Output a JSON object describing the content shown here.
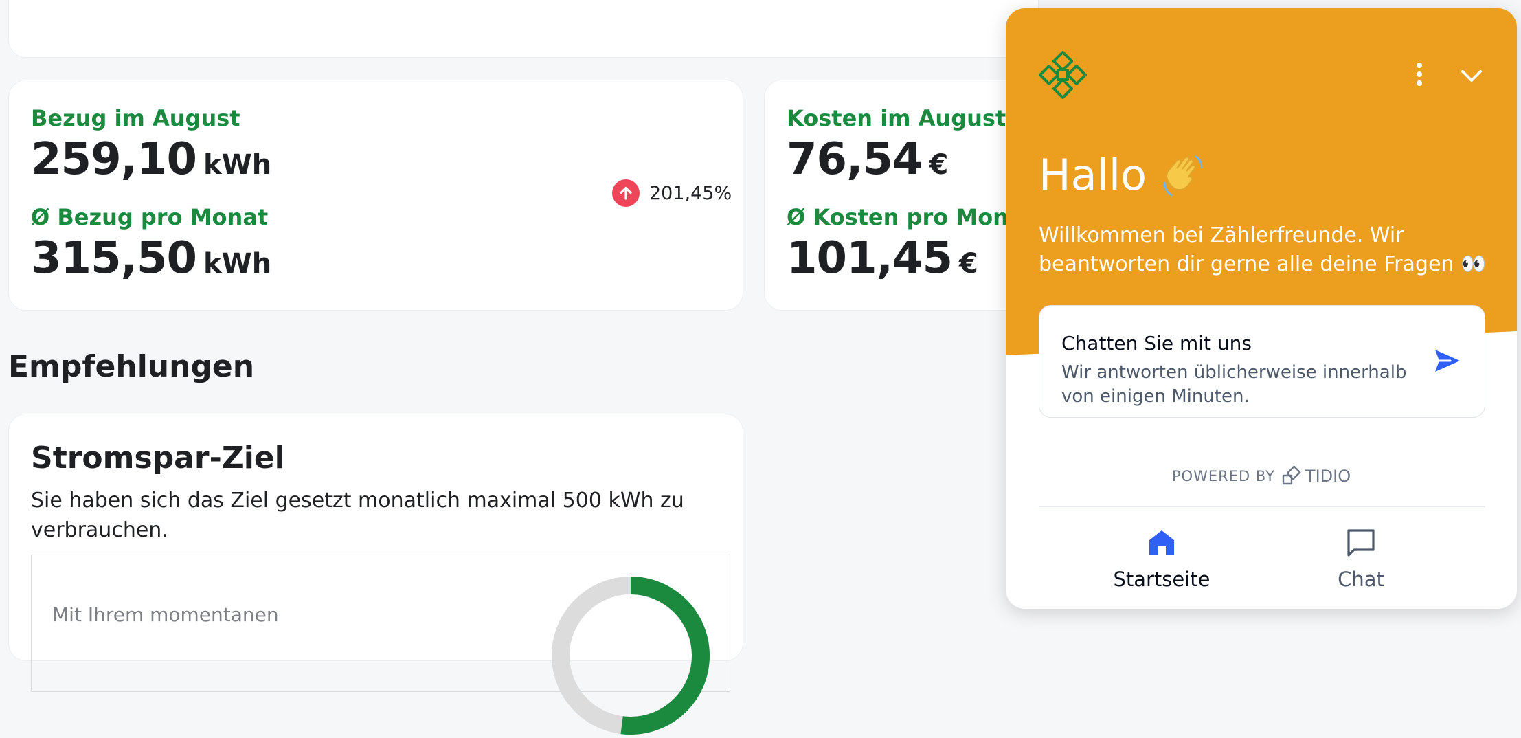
{
  "stats": {
    "bezug": {
      "label": "Bezug im August",
      "value": "259,10",
      "unit": "kWh",
      "avg_label": "Ø Bezug pro Monat",
      "avg_value": "315,50",
      "avg_unit": "kWh",
      "trend_value": "201,45%"
    },
    "kosten": {
      "label": "Kosten im August",
      "value": "76,54",
      "unit": "€",
      "avg_label": "Ø Kosten pro Monat",
      "avg_value": "101,45",
      "avg_unit": "€"
    }
  },
  "recommendations": {
    "section_title": "Empfehlungen",
    "goal": {
      "title": "Stromspar-Ziel",
      "description": "Sie haben sich das Ziel gesetzt monatlich maximal 500 kWh zu verbrauchen.",
      "inner_text": "Mit Ihrem momentanen",
      "progress": 0.52
    }
  },
  "chat": {
    "greeting": "Hallo",
    "welcome": "Willkommen bei Zählerfreunde. Wir beantworten dir gerne alle deine Fragen 👀",
    "cta_title": "Chatten Sie mit uns",
    "cta_subtitle": "Wir antworten üblicherweise innerhalb von einigen Minuten.",
    "powered_by": "POWERED BY",
    "powered_brand": "TIDIO",
    "nav": {
      "home": "Startseite",
      "chat": "Chat"
    }
  },
  "colors": {
    "accent_green": "#1b8a3f",
    "chat_orange": "#ec9e1f",
    "trend_red": "#ee4658",
    "send_blue": "#2f5ff5"
  }
}
